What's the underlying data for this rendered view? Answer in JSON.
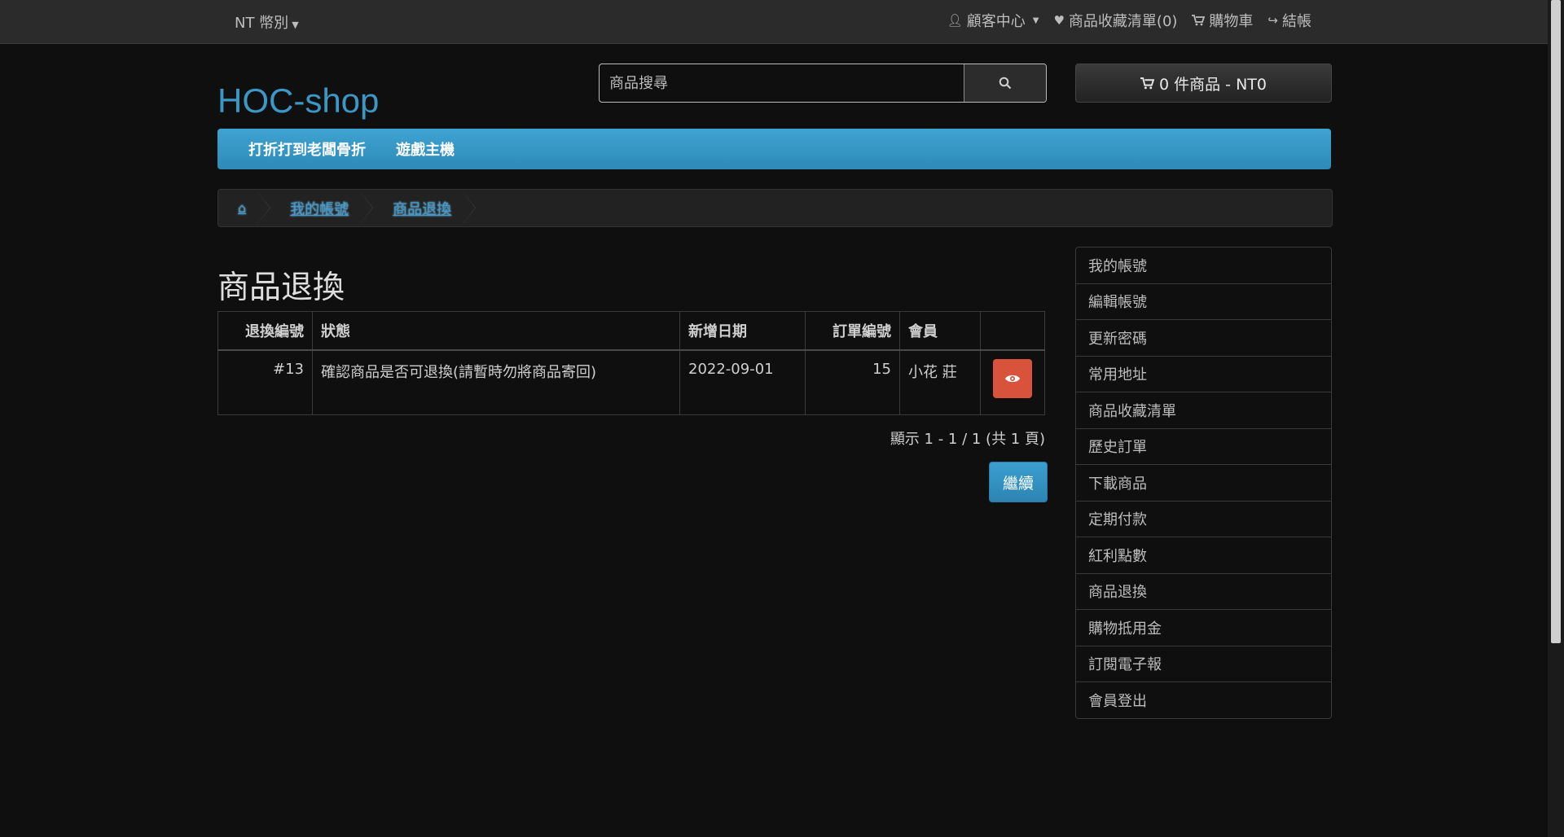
{
  "topbar": {
    "currency_label": "NT 幣別",
    "links": [
      {
        "label": "顧客中心",
        "icon": "user-icon"
      },
      {
        "label": "商品收藏清單(0)",
        "icon": "heart-icon"
      },
      {
        "label": "購物車",
        "icon": "cart-icon"
      },
      {
        "label": "結帳",
        "icon": "share-icon"
      }
    ]
  },
  "header": {
    "logo": "HOC-shop",
    "search_placeholder": "商品搜尋",
    "cart_label": "0 件商品 - NT0"
  },
  "menu": {
    "items": [
      "打折打到老闆骨折",
      "遊戲主機"
    ]
  },
  "breadcrumb": {
    "items": [
      "我的帳號",
      "商品退換"
    ]
  },
  "main": {
    "title": "商品退換",
    "table": {
      "headers": [
        "退換編號",
        "狀態",
        "新增日期",
        "訂單編號",
        "會員",
        ""
      ],
      "rows": [
        {
          "return_id": "#13",
          "status": "確認商品是否可退換(請暫時勿將商品寄回)",
          "date": "2022-09-01",
          "order_id": "15",
          "member": "小花 莊"
        }
      ]
    },
    "pagination_text": "顯示 1 - 1 / 1 (共 1 頁)",
    "continue_label": "繼續"
  },
  "sidebar": {
    "items": [
      "我的帳號",
      "編輯帳號",
      "更新密碼",
      "常用地址",
      "商品收藏清單",
      "歷史訂單",
      "下載商品",
      "定期付款",
      "紅利點數",
      "商品退換",
      "購物抵用金",
      "訂閱電子報",
      "會員登出"
    ]
  },
  "colors": {
    "accent": "#3a97c6",
    "danger": "#d9533c",
    "background": "#0f0f0f"
  }
}
